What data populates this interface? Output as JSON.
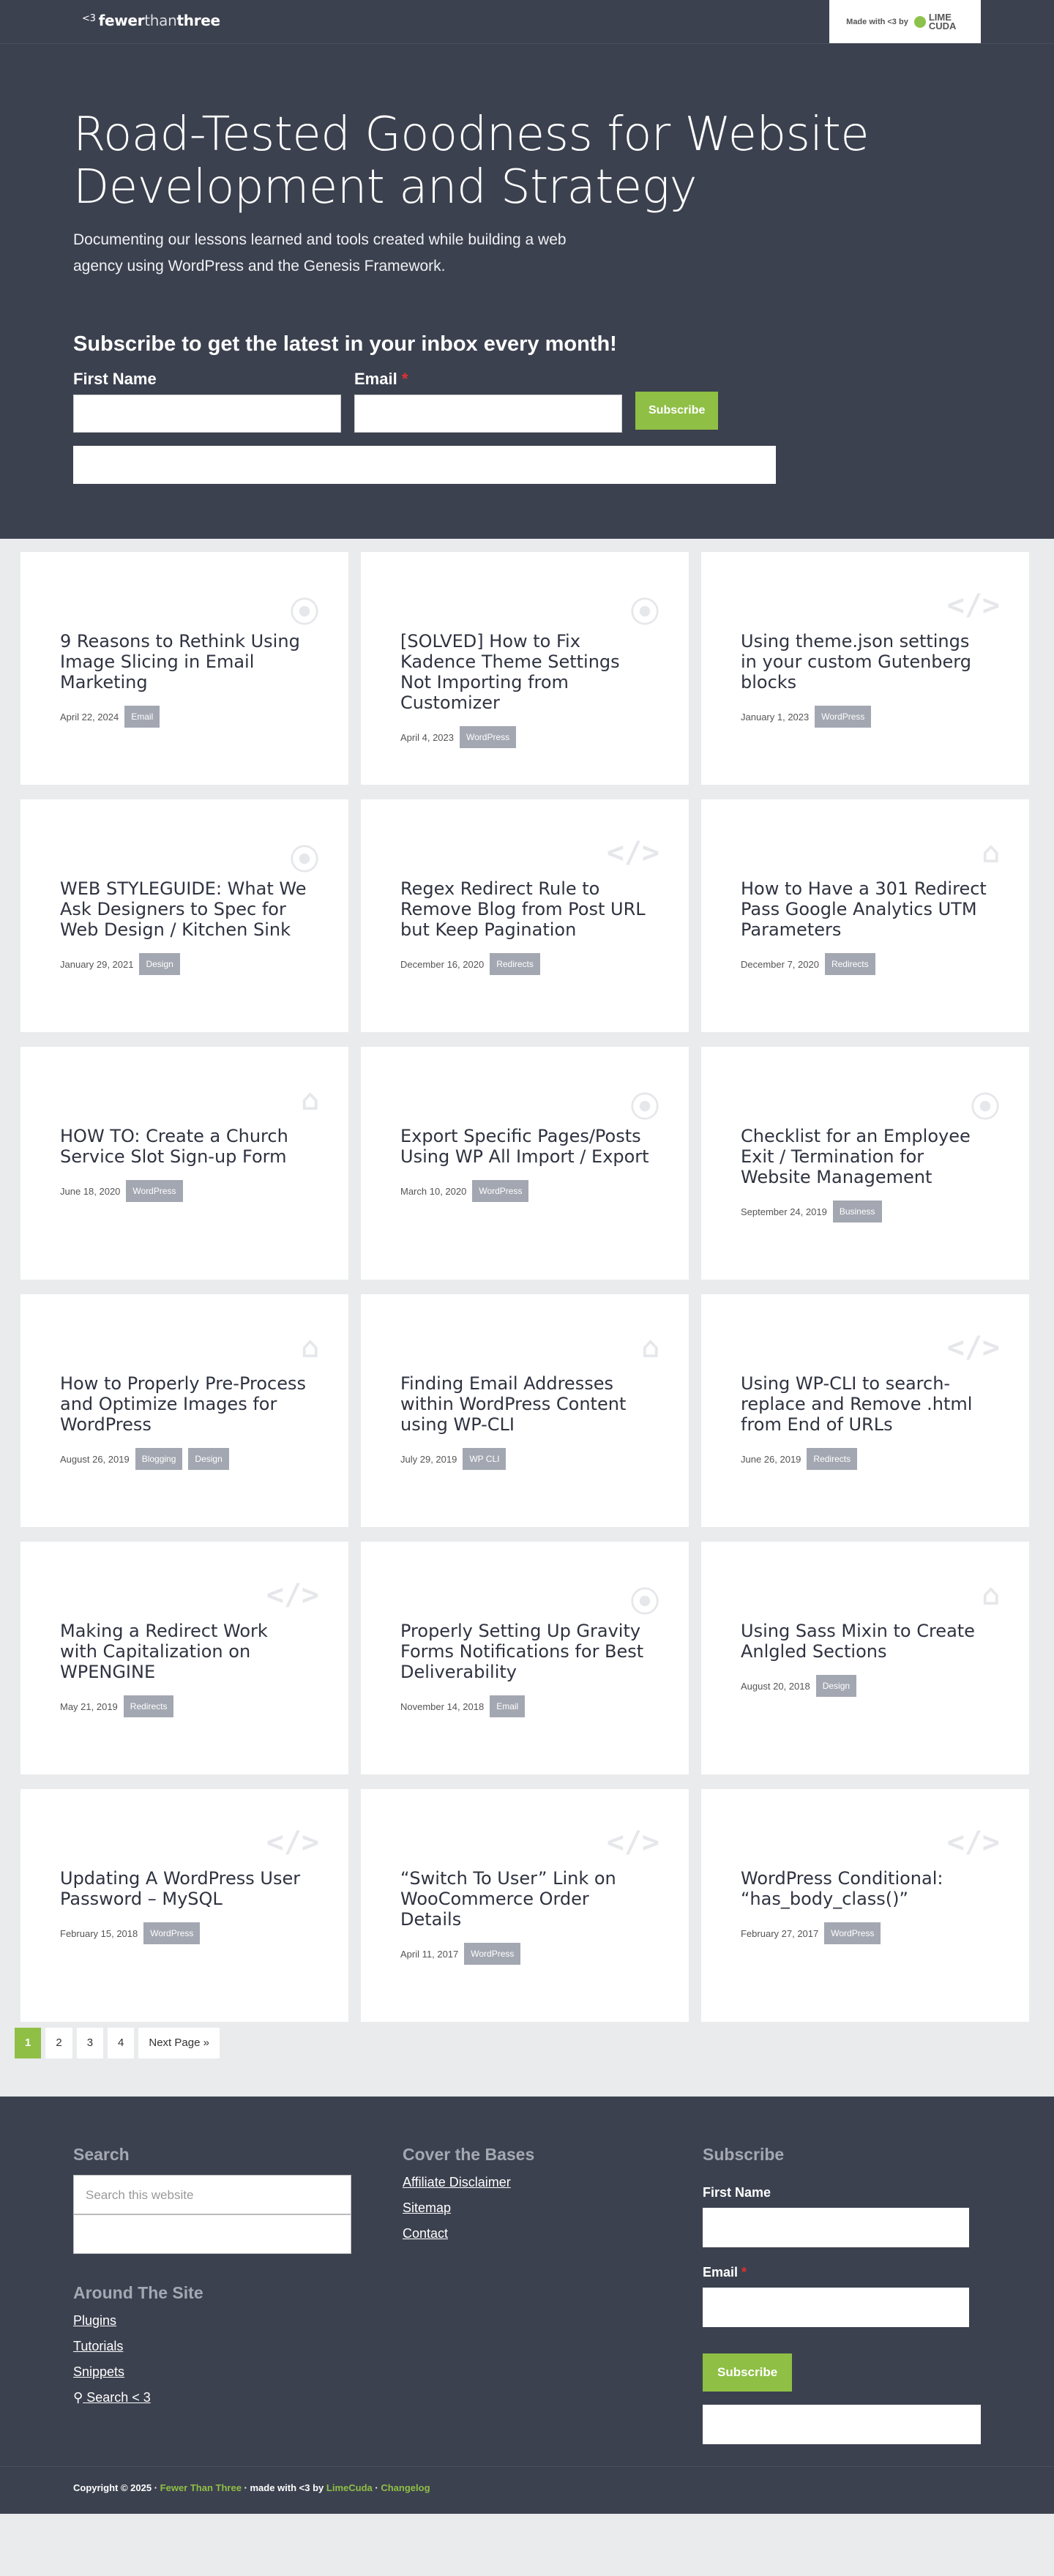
{
  "header": {
    "logo_lt": "<3",
    "logo_fewer": "fewer",
    "logo_than": "than",
    "logo_three": "three",
    "made_with": "Made with <3 by",
    "lime_text": "LIME CUDA"
  },
  "hero": {
    "title": "Road-Tested Goodness for Website Development and Strategy",
    "lead": "Documenting our lessons learned and tools created while building a web agency using WordPress and the Genesis Framework.",
    "subscribe_heading": "Subscribe to get the latest in your inbox every month!",
    "first_name_label": "First Name",
    "email_label": "Email",
    "required_mark": "*",
    "subscribe_label": "Subscribe"
  },
  "posts": [
    {
      "title": "9 Reasons to Rethink Using Image Slicing in Email Marketing",
      "date": "April 22, 2024",
      "tags": [
        "Email"
      ],
      "icon": "rss-icon"
    },
    {
      "title": "[SOLVED] How to Fix Kadence Theme Settings Not Importing from Customizer",
      "date": "April 4, 2023",
      "tags": [
        "WordPress"
      ],
      "icon": "rss-icon"
    },
    {
      "title": "Using theme.json settings in your custom Gutenberg blocks",
      "date": "January 1, 2023",
      "tags": [
        "WordPress"
      ],
      "icon": "code-icon"
    },
    {
      "title": "WEB STYLEGUIDE: What We Ask Designers to Spec for Web Design / Kitchen Sink",
      "date": "January 29, 2021",
      "tags": [
        "Design"
      ],
      "icon": "rss-icon"
    },
    {
      "title": "Regex Redirect Rule to Remove Blog from Post URL but Keep Pagination",
      "date": "December 16, 2020",
      "tags": [
        "Redirects"
      ],
      "icon": "code-icon"
    },
    {
      "title": "How to Have a 301 Redirect Pass Google Analytics UTM Parameters",
      "date": "December 7, 2020",
      "tags": [
        "Redirects"
      ],
      "icon": "graduation-cap-icon"
    },
    {
      "title": "HOW TO: Create a Church Service Slot Sign-up Form",
      "date": "June 18, 2020",
      "tags": [
        "WordPress"
      ],
      "icon": "graduation-cap-icon"
    },
    {
      "title": "Export Specific Pages/Posts Using WP All Import / Export",
      "date": "March 10, 2020",
      "tags": [
        "WordPress"
      ],
      "icon": "rss-icon"
    },
    {
      "title": "Checklist for an Employee Exit / Termination for Website Management",
      "date": "September 24, 2019",
      "tags": [
        "Business"
      ],
      "icon": "rss-icon"
    },
    {
      "title": "How to Properly Pre-Process and Optimize Images for WordPress",
      "date": "August 26, 2019",
      "tags": [
        "Blogging",
        "Design"
      ],
      "icon": "graduation-cap-icon"
    },
    {
      "title": "Finding Email Addresses within WordPress Content using WP-CLI",
      "date": "July 29, 2019",
      "tags": [
        "WP CLI"
      ],
      "icon": "graduation-cap-icon"
    },
    {
      "title": "Using WP-CLI to search-replace and Remove .html from End of URLs",
      "date": "June 26, 2019",
      "tags": [
        "Redirects"
      ],
      "icon": "code-icon"
    },
    {
      "title": "Making a Redirect Work with Capitalization on WPENGINE",
      "date": "May 21, 2019",
      "tags": [
        "Redirects"
      ],
      "icon": "code-icon"
    },
    {
      "title": "Properly Setting Up Gravity Forms Notifications for Best Deliverability",
      "date": "November 14, 2018",
      "tags": [
        "Email"
      ],
      "icon": "rss-icon"
    },
    {
      "title": "Using Sass Mixin to Create Anlgled Sections",
      "date": "August 20, 2018",
      "tags": [
        "Design"
      ],
      "icon": "graduation-cap-icon"
    },
    {
      "title": "Updating A WordPress User Password – MySQL",
      "date": "February 15, 2018",
      "tags": [
        "WordPress"
      ],
      "icon": "code-icon"
    },
    {
      "title": "“Switch To User” Link on WooCommerce Order Details",
      "date": "April 11, 2017",
      "tags": [
        "WordPress"
      ],
      "icon": "code-icon"
    },
    {
      "title": "WordPress Conditional: “has_body_class()”",
      "date": "February 27, 2017",
      "tags": [
        "WordPress"
      ],
      "icon": "code-icon"
    }
  ],
  "pagination": {
    "pages": [
      "1",
      "2",
      "3",
      "4"
    ],
    "next_label": "Next Page »"
  },
  "footer": {
    "search_heading": "Search",
    "search_placeholder": "Search this website",
    "around_heading": "Around The Site",
    "around_links": [
      "Plugins",
      "Tutorials",
      "Snippets"
    ],
    "search_link": "Search < 3",
    "bases_heading": "Cover the Bases",
    "bases_links": [
      "Affiliate Disclaimer",
      "Sitemap",
      "Contact"
    ],
    "subscribe_heading": "Subscribe",
    "first_name_label": "First Name",
    "email_label": "Email",
    "required_mark": "*",
    "subscribe_label": "Subscribe",
    "copyright_prefix": "Copyright © 2025 ·",
    "site_link": "Fewer Than Three",
    "made_with": "· made with <3 by",
    "lime_link": "LimeCuda",
    "sep": "·",
    "changelog_link": "Changelog"
  },
  "colors": {
    "dark_bg": "#3c414f",
    "accent": "#8fbf45",
    "tag_bg": "#a3a7b1",
    "page_bg": "#e9ebec"
  }
}
